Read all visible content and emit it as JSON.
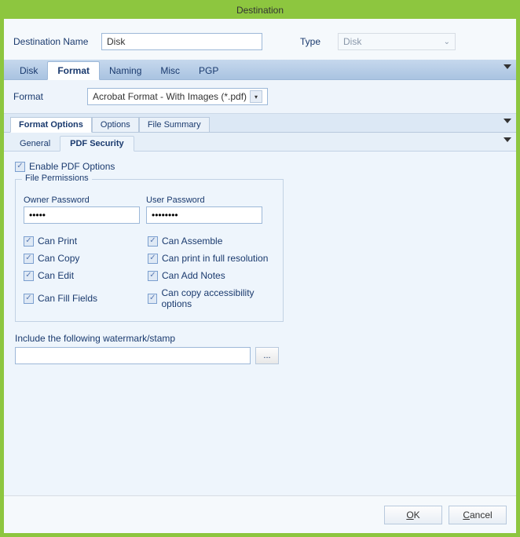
{
  "window": {
    "title": "Destination"
  },
  "top": {
    "dest_label": "Destination Name",
    "dest_value": "Disk",
    "type_label": "Type",
    "type_value": "Disk"
  },
  "tabs1": {
    "items": [
      "Disk",
      "Format",
      "Naming",
      "Misc",
      "PGP"
    ],
    "active": "Format"
  },
  "format": {
    "label": "Format",
    "value": "Acrobat Format - With Images (*.pdf)"
  },
  "tabs2": {
    "items": [
      "Format Options",
      "Options",
      "File Summary"
    ],
    "active": "Format Options"
  },
  "tabs3": {
    "items": [
      "General",
      "PDF Security"
    ],
    "active": "PDF Security"
  },
  "pdf": {
    "enable_label": "Enable PDF Options",
    "enable_checked": true,
    "legend": "File Permissions",
    "owner_label": "Owner Password",
    "owner_value": "•••••",
    "user_label": "User Password",
    "user_value": "••••••••",
    "perms": [
      {
        "label": "Can Print",
        "checked": true
      },
      {
        "label": "Can Assemble",
        "checked": true
      },
      {
        "label": "Can Copy",
        "checked": true
      },
      {
        "label": "Can print in full resolution",
        "checked": true
      },
      {
        "label": "Can Edit",
        "checked": true
      },
      {
        "label": "Can Add Notes",
        "checked": true
      },
      {
        "label": "Can Fill Fields",
        "checked": true
      },
      {
        "label": "Can copy accessibility options",
        "checked": true
      }
    ],
    "watermark_label": "Include the following watermark/stamp",
    "watermark_value": "",
    "browse_label": "..."
  },
  "footer": {
    "ok": "OK",
    "cancel": "Cancel"
  }
}
